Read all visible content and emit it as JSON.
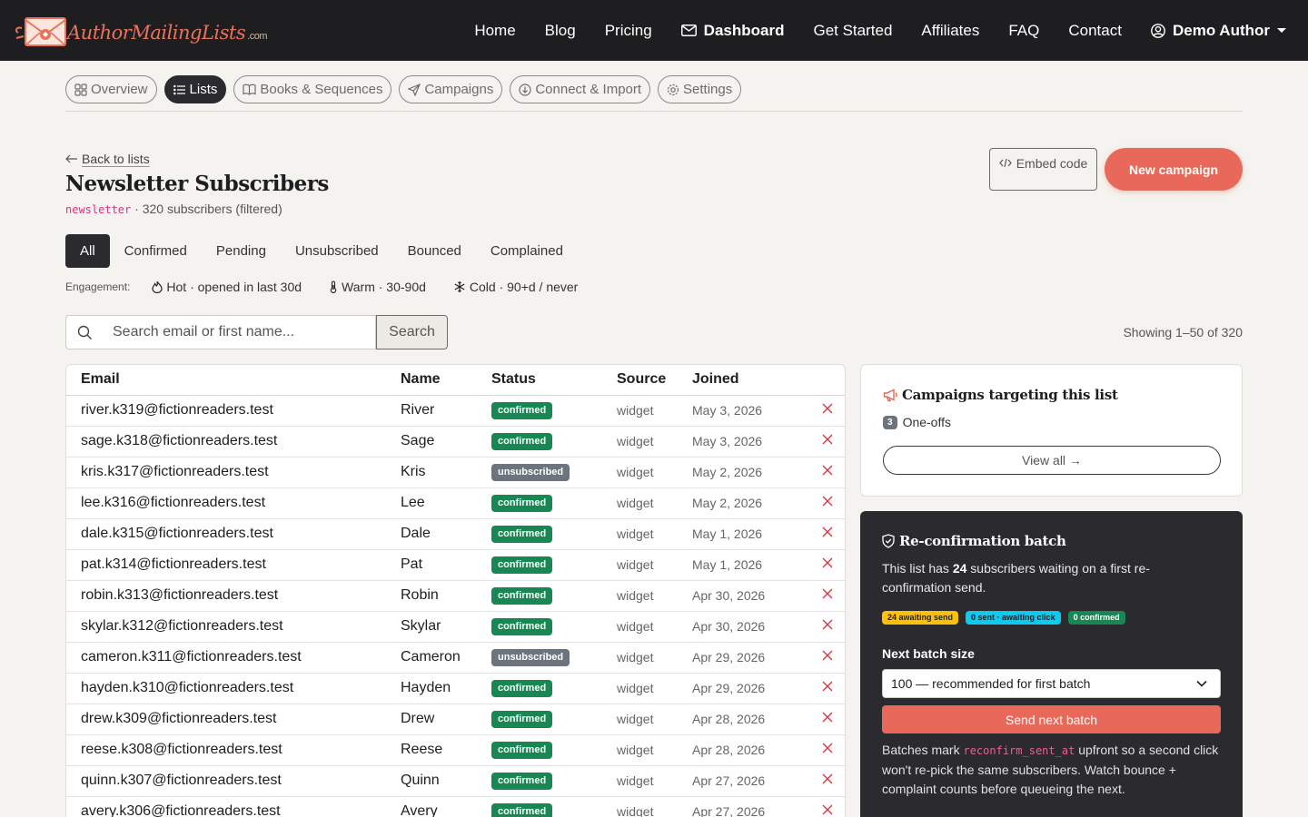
{
  "brand": {
    "name": "AuthorMailingLists",
    "tld": ".com",
    "accent": "#e8725c"
  },
  "nav": {
    "home": "Home",
    "blog": "Blog",
    "pricing": "Pricing",
    "dashboard": "Dashboard",
    "get_started": "Get Started",
    "affiliates": "Affiliates",
    "faq": "FAQ",
    "contact": "Contact",
    "user": "Demo Author"
  },
  "subnav": {
    "overview": "Overview",
    "lists": "Lists",
    "books": "Books & Sequences",
    "campaigns": "Campaigns",
    "connect": "Connect & Import",
    "settings": "Settings"
  },
  "header": {
    "back": "Back to lists",
    "title": "Newsletter Subscribers",
    "slug": "newsletter",
    "count": " · 320 subscribers (filtered)",
    "embed": "Embed code",
    "new_campaign": "New campaign"
  },
  "tabs": [
    "All",
    "Confirmed",
    "Pending",
    "Unsubscribed",
    "Bounced",
    "Complained"
  ],
  "engagement": {
    "label": "Engagement:",
    "hot": "Hot · opened in last 30d",
    "warm": "Warm · 30-90d",
    "cold": "Cold · 90+d / never"
  },
  "search": {
    "placeholder": "Search email or first name...",
    "button": "Search"
  },
  "showing": "Showing 1–50 of 320",
  "table": {
    "headers": [
      "Email",
      "Name",
      "Status",
      "Source",
      "Joined"
    ],
    "rows": [
      {
        "email": "river.k319@fictionreaders.test",
        "name": "River",
        "status": "confirmed",
        "source": "widget",
        "joined": "May 3, 2026"
      },
      {
        "email": "sage.k318@fictionreaders.test",
        "name": "Sage",
        "status": "confirmed",
        "source": "widget",
        "joined": "May 3, 2026"
      },
      {
        "email": "kris.k317@fictionreaders.test",
        "name": "Kris",
        "status": "unsubscribed",
        "source": "widget",
        "joined": "May 2, 2026"
      },
      {
        "email": "lee.k316@fictionreaders.test",
        "name": "Lee",
        "status": "confirmed",
        "source": "widget",
        "joined": "May 2, 2026"
      },
      {
        "email": "dale.k315@fictionreaders.test",
        "name": "Dale",
        "status": "confirmed",
        "source": "widget",
        "joined": "May 1, 2026"
      },
      {
        "email": "pat.k314@fictionreaders.test",
        "name": "Pat",
        "status": "confirmed",
        "source": "widget",
        "joined": "May 1, 2026"
      },
      {
        "email": "robin.k313@fictionreaders.test",
        "name": "Robin",
        "status": "confirmed",
        "source": "widget",
        "joined": "Apr 30, 2026"
      },
      {
        "email": "skylar.k312@fictionreaders.test",
        "name": "Skylar",
        "status": "confirmed",
        "source": "widget",
        "joined": "Apr 30, 2026"
      },
      {
        "email": "cameron.k311@fictionreaders.test",
        "name": "Cameron",
        "status": "unsubscribed",
        "source": "widget",
        "joined": "Apr 29, 2026"
      },
      {
        "email": "hayden.k310@fictionreaders.test",
        "name": "Hayden",
        "status": "confirmed",
        "source": "widget",
        "joined": "Apr 29, 2026"
      },
      {
        "email": "drew.k309@fictionreaders.test",
        "name": "Drew",
        "status": "confirmed",
        "source": "widget",
        "joined": "Apr 28, 2026"
      },
      {
        "email": "reese.k308@fictionreaders.test",
        "name": "Reese",
        "status": "confirmed",
        "source": "widget",
        "joined": "Apr 28, 2026"
      },
      {
        "email": "quinn.k307@fictionreaders.test",
        "name": "Quinn",
        "status": "confirmed",
        "source": "widget",
        "joined": "Apr 27, 2026"
      },
      {
        "email": "avery.k306@fictionreaders.test",
        "name": "Avery",
        "status": "confirmed",
        "source": "widget",
        "joined": "Apr 27, 2026"
      }
    ]
  },
  "campaigns_card": {
    "title": "Campaigns targeting this list",
    "count": "3",
    "count_label": "One-offs",
    "view_all": "View all →"
  },
  "reconfirm": {
    "title": "Re-confirmation batch",
    "desc_pre": "This list has ",
    "desc_num": "24",
    "desc_post": " subscribers waiting on a first re-confirmation send.",
    "badge_awaiting": "24 awaiting send",
    "badge_sent": "0 sent · awaiting click",
    "badge_confirmed": "0 confirmed",
    "batch_label": "Next batch size",
    "batch_value": "100 — recommended for first batch",
    "send": "Send next batch",
    "note_pre": "Batches mark ",
    "note_code": "reconfirm_sent_at",
    "note_post": " upfront so a second click won't re-pick the same subscribers. Watch bounce + complaint counts before queueing the next."
  },
  "colors": {
    "accent": "#e8695a",
    "dark": "#2b2b2f",
    "confirmed": "#198754",
    "unsubscribed": "#6c757d"
  }
}
